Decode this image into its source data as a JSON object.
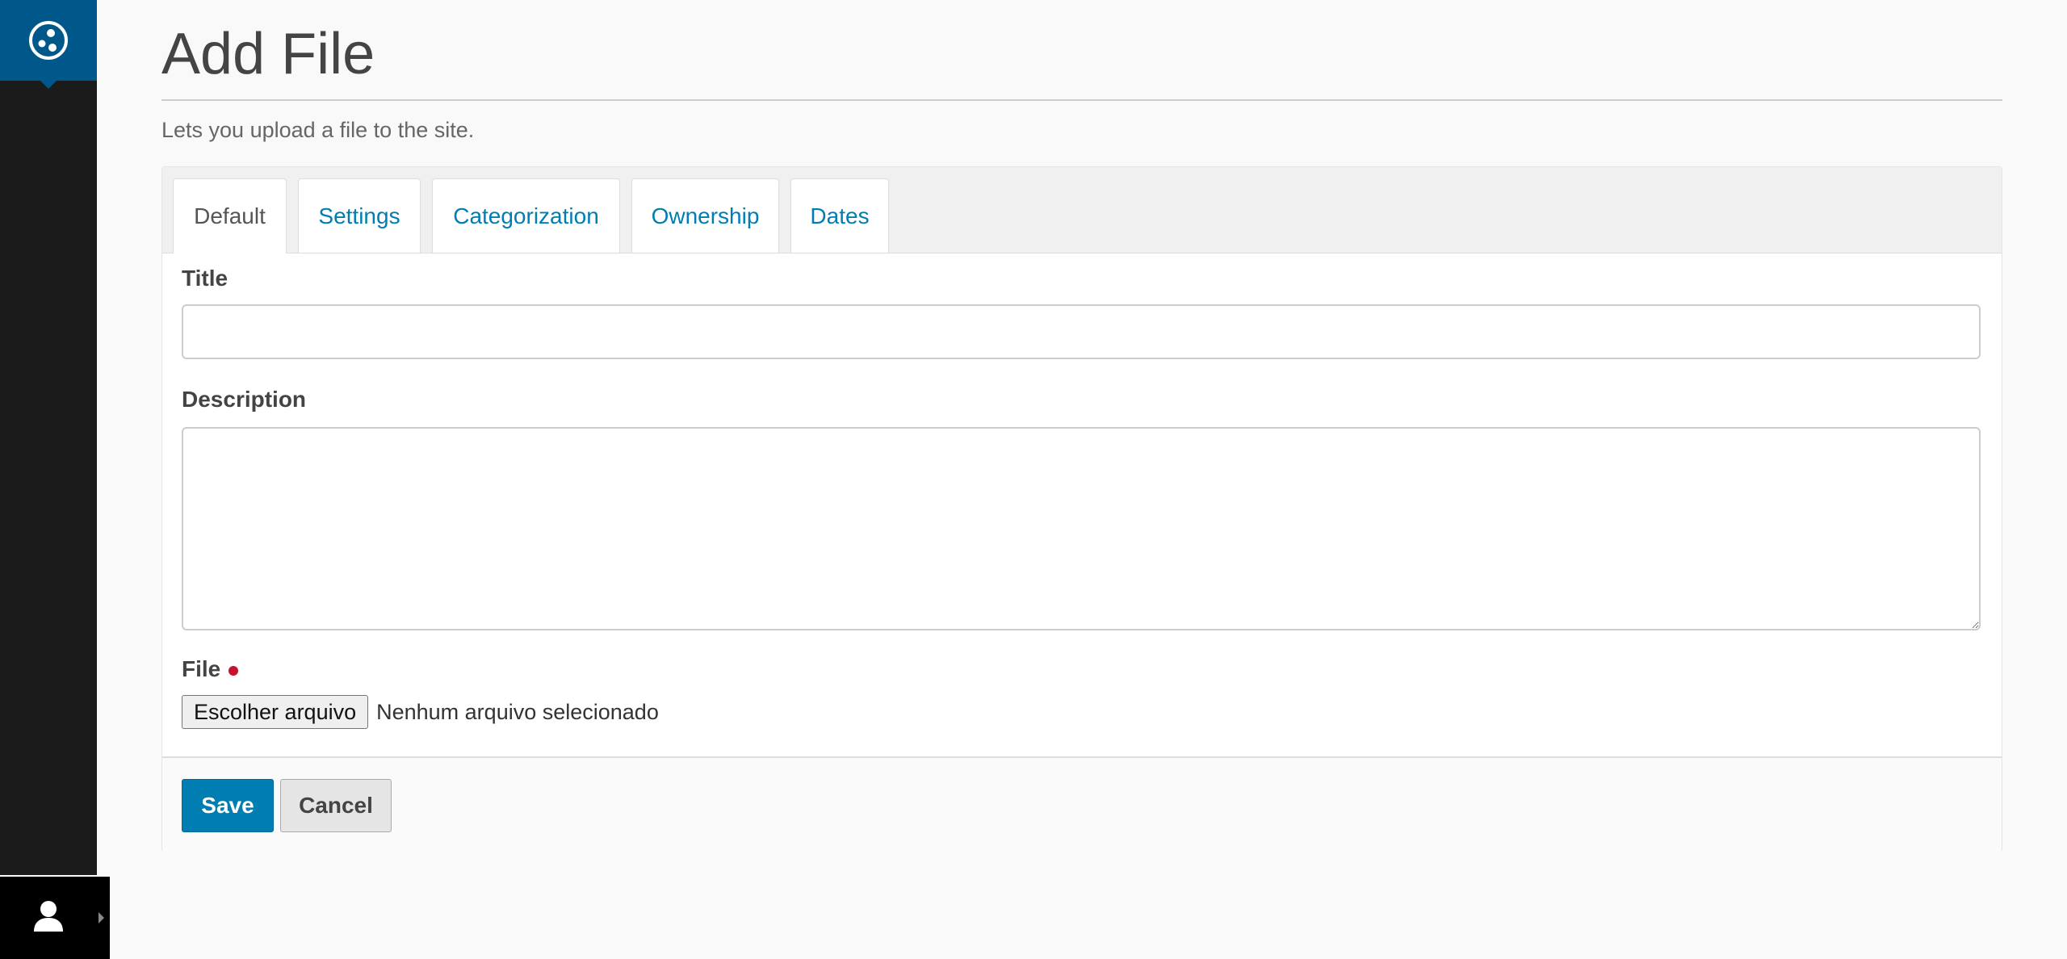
{
  "toolbar": {
    "logo_icon": "plone-logo-icon",
    "user_icon": "user-icon"
  },
  "page": {
    "title": "Add File",
    "lead": "Lets you upload a file to the site."
  },
  "tabs": [
    {
      "label": "Default",
      "active": true
    },
    {
      "label": "Settings",
      "active": false
    },
    {
      "label": "Categorization",
      "active": false
    },
    {
      "label": "Ownership",
      "active": false
    },
    {
      "label": "Dates",
      "active": false
    }
  ],
  "form": {
    "title_label": "Title",
    "title_value": "",
    "description_label": "Description",
    "description_value": "",
    "file_label": "File",
    "file_button": "Escolher arquivo",
    "file_status": "Nenhum arquivo selecionado",
    "save_label": "Save",
    "cancel_label": "Cancel"
  },
  "colors": {
    "accent": "#007eb1",
    "logo_bg": "#00578a",
    "sidebar_bg": "#1b1b1b",
    "required": "#c4122f"
  }
}
